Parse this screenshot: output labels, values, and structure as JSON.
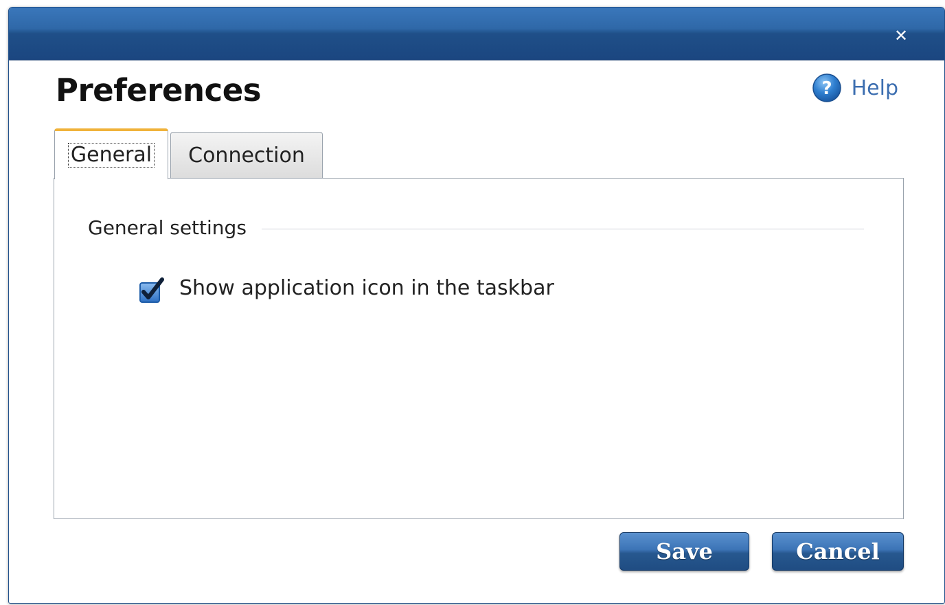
{
  "dialog": {
    "title": "Preferences",
    "close_icon": "close-icon",
    "help": {
      "label": "Help",
      "icon": "help-question-icon"
    }
  },
  "tabs": [
    {
      "label": "General",
      "selected": true
    },
    {
      "label": "Connection",
      "selected": false
    }
  ],
  "general": {
    "section_title": "General settings",
    "show_taskbar_icon": {
      "label": "Show application icon in the taskbar",
      "checked": true
    }
  },
  "buttons": {
    "save_label": "Save",
    "cancel_label": "Cancel"
  },
  "colors": {
    "titlebar": "#2f68a8",
    "selected_tab_accent": "#f0b23a",
    "button_blue": "#2f62a0",
    "help_link": "#3c6eb0"
  }
}
